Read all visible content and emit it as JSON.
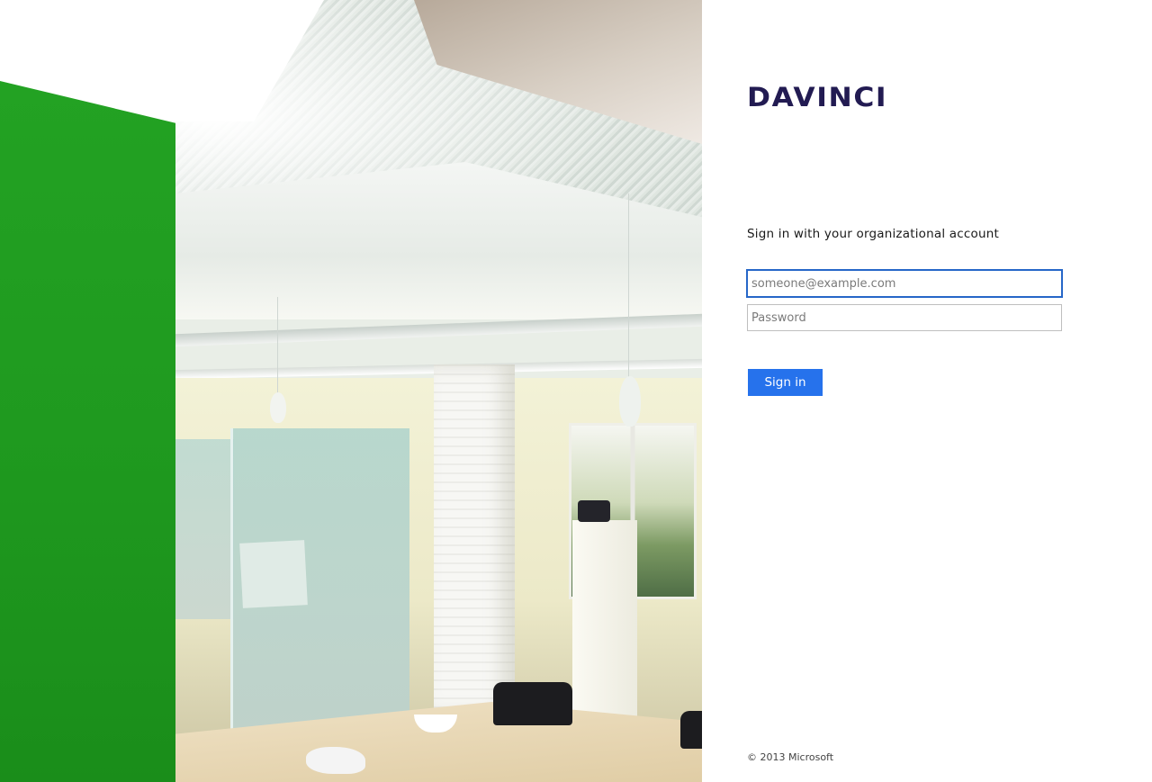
{
  "brand": {
    "logo_text": "DAVINCI",
    "logo_color": "#221b52"
  },
  "login": {
    "heading": "Sign in with your organizational account",
    "email_placeholder": "someone@example.com",
    "email_value": "",
    "password_placeholder": "Password",
    "password_value": "",
    "submit_label": "Sign in",
    "accent_color": "#2672ec"
  },
  "footer": {
    "copyright": "© 2013 Microsoft"
  }
}
